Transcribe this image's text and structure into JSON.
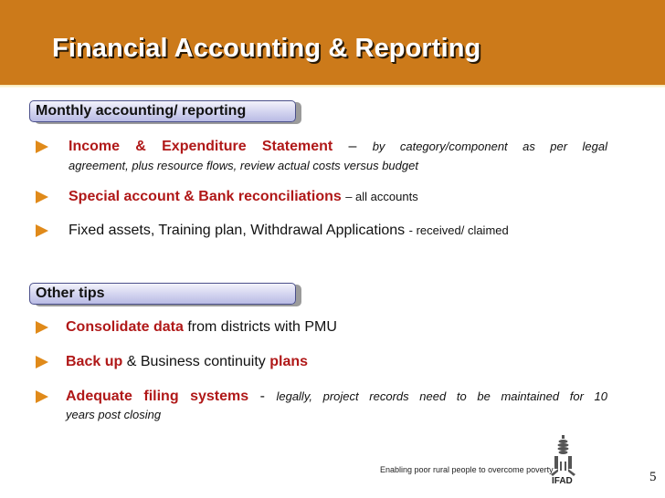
{
  "slide": {
    "title": "Financial Accounting & Reporting",
    "page_number": "5",
    "colors": {
      "header_bg": "#cc7a1a",
      "accent_red": "#b01818",
      "bullet": "#e08a1a"
    }
  },
  "sections": [
    {
      "heading": "Monthly accounting/ reporting",
      "items": [
        {
          "bold": "Income & Expenditure Statement",
          "dash": "–",
          "rest_line1": "by category/component as per legal",
          "rest_line2": "agreement, plus resource flows, review actual costs versus budget"
        },
        {
          "bold": "Special account & Bank reconciliations",
          "rest": "– all accounts"
        },
        {
          "main": "Fixed assets, Training plan, Withdrawal Applications",
          "rest": "- received/ claimed"
        }
      ]
    },
    {
      "heading": "Other tips",
      "items": [
        {
          "bold": "Consolidate data",
          "rest": "from districts with PMU"
        },
        {
          "bold": "Back up",
          "middle": "& Business continuity",
          "bold2": "plans"
        },
        {
          "bold": "Adequate filing systems",
          "dash": "-",
          "rest_line1": "legally, project records need to be maintained for 10",
          "rest_line2": "years post closing"
        }
      ]
    }
  ],
  "footer": {
    "tagline": "Enabling poor rural people to overcome poverty",
    "logo_text": "IFAD",
    "logo_icon": "ifad-wheat-logo-icon"
  }
}
